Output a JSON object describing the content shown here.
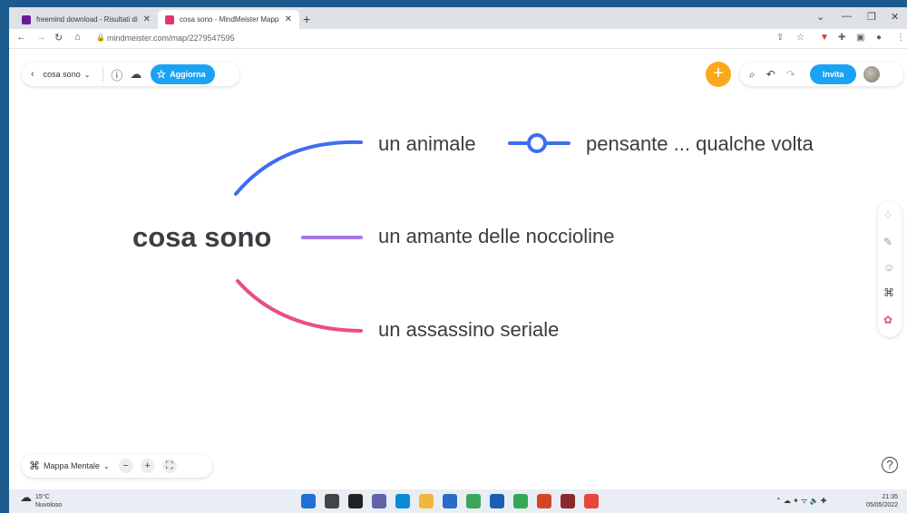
{
  "browser": {
    "tabs": [
      {
        "title": "freemind download - Risultati di",
        "favicon_color": "#6a1b9a"
      },
      {
        "title": "cosa sono - MindMeister Mappa",
        "favicon_color": "#e0366e"
      }
    ],
    "url": "mindmeister.com/map/2279547595"
  },
  "toolbar": {
    "map_name": "cosa sono",
    "update_label": "Aggiorna",
    "invite_label": "Invita"
  },
  "map": {
    "root": "cosa sono",
    "branches": [
      {
        "label": "un animale",
        "color": "#3d6df2",
        "child": "pensante ... qualche volta"
      },
      {
        "label": "un amante delle noccioline",
        "color": "#a477ea"
      },
      {
        "label": "un assassino seriale",
        "color": "#e84f83"
      }
    ]
  },
  "bottom": {
    "view_label": "Mappa Mentale",
    "zoom_out": "−",
    "zoom_in": "+"
  },
  "taskbar": {
    "temperature": "15°C",
    "weather": "Nuvoloso",
    "time": "21:35",
    "date": "05/05/2022"
  }
}
